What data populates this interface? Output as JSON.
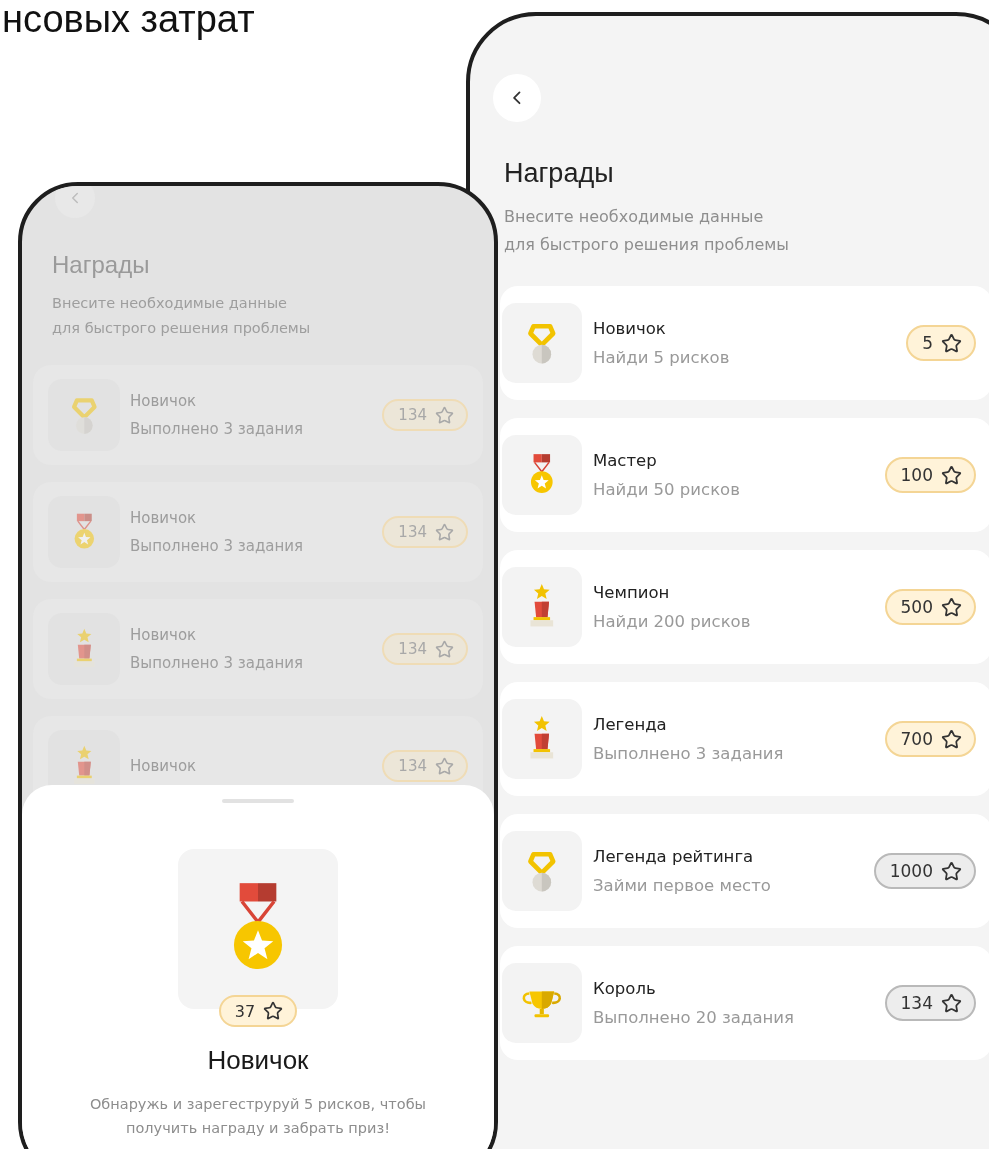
{
  "headline": "нсовых затрат",
  "screens": [
    {
      "dimmed": true,
      "title": "Награды",
      "subtitle_lines": [
        "Внесите необходимые данные",
        "для быстрого решения проблемы"
      ],
      "items": [
        {
          "kind": "shield-medal",
          "name": "Новичок",
          "task": "Выполнено 3 задания",
          "points": "134",
          "earned": true
        },
        {
          "kind": "ribbon-medal",
          "name": "Новичок",
          "task": "Выполнено 3 задания",
          "points": "134",
          "earned": true
        },
        {
          "kind": "star-trophy",
          "name": "Новичок",
          "task": "Выполнено 3 задания",
          "points": "134",
          "earned": true
        },
        {
          "kind": "star-trophy",
          "name": "Новичок",
          "points": "134",
          "earned": true
        }
      ],
      "sheet": {
        "kind": "ribbon-medal",
        "points": "37",
        "title": "Новичок",
        "text": "Обнаружь и зарегеструруй 5 рисков, чтобы получить награду и забрать приз!"
      }
    },
    {
      "dimmed": false,
      "title": "Награды",
      "subtitle_lines": [
        "Внесите необходимые данные",
        "для быстрого решения проблемы"
      ],
      "items": [
        {
          "kind": "shield-medal",
          "name": "Новичок",
          "task": "Найди 5 рисков",
          "points": "5",
          "earned": true
        },
        {
          "kind": "ribbon-medal",
          "name": "Мастер",
          "task": "Найди 50 рисков",
          "points": "100",
          "earned": true
        },
        {
          "kind": "star-trophy",
          "name": "Чемпион",
          "task": "Найди 200 рисков",
          "points": "500",
          "earned": true
        },
        {
          "kind": "star-trophy",
          "name": "Легенда",
          "task": "Выполнено 3 задания",
          "points": "700",
          "earned": true
        },
        {
          "kind": "shield-medal",
          "name": "Легенда рейтинга",
          "task": "Займи первое место",
          "points": "1000",
          "earned": false
        },
        {
          "kind": "cup",
          "name": "Король",
          "task": "Выполнено 20 задания",
          "points": "134",
          "earned": false
        }
      ]
    }
  ]
}
